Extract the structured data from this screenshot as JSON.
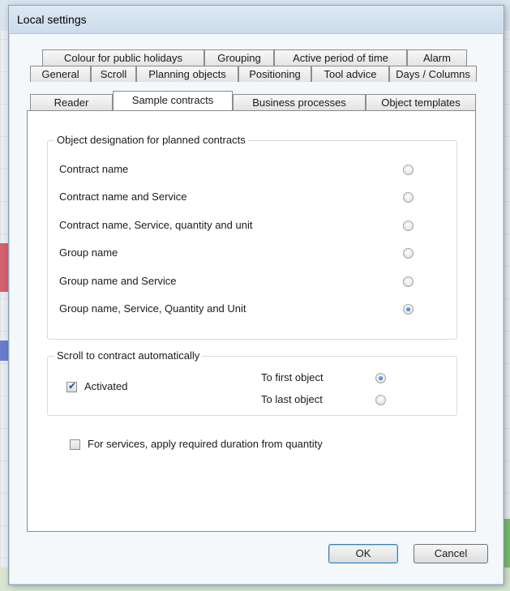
{
  "window": {
    "title": "Local settings"
  },
  "tabs": {
    "row1": [
      "Colour for public holidays",
      "Grouping",
      "Active period of time",
      "Alarm"
    ],
    "row2": [
      "General",
      "Scroll",
      "Planning objects",
      "Positioning",
      "Tool advice",
      "Days / Columns"
    ],
    "row3": [
      "Reader",
      "Sample contracts",
      "Business processes",
      "Object templates"
    ],
    "active": "Sample contracts"
  },
  "designation": {
    "legend": "Object designation for planned contracts",
    "options": [
      {
        "label": "Contract name",
        "checked": false
      },
      {
        "label": "Contract name and Service",
        "checked": false
      },
      {
        "label": "Contract name, Service, quantity and unit",
        "checked": false
      },
      {
        "label": "Group name",
        "checked": false
      },
      {
        "label": "Group name and Service",
        "checked": false
      },
      {
        "label": "Group name, Service, Quantity and Unit",
        "checked": true
      }
    ]
  },
  "scroll": {
    "legend": "Scroll to contract automatically",
    "activated_label": "Activated",
    "activated_checked": true,
    "first_label": "To first object",
    "first_checked": true,
    "last_label": "To last object",
    "last_checked": false
  },
  "services": {
    "label": "For services, apply required duration from quantity",
    "checked": false
  },
  "buttons": {
    "ok": "OK",
    "cancel": "Cancel"
  },
  "colors": {
    "accent": "#1b5fb3",
    "panel_bg": "#ffffff",
    "title_bg": "#cddcec"
  }
}
